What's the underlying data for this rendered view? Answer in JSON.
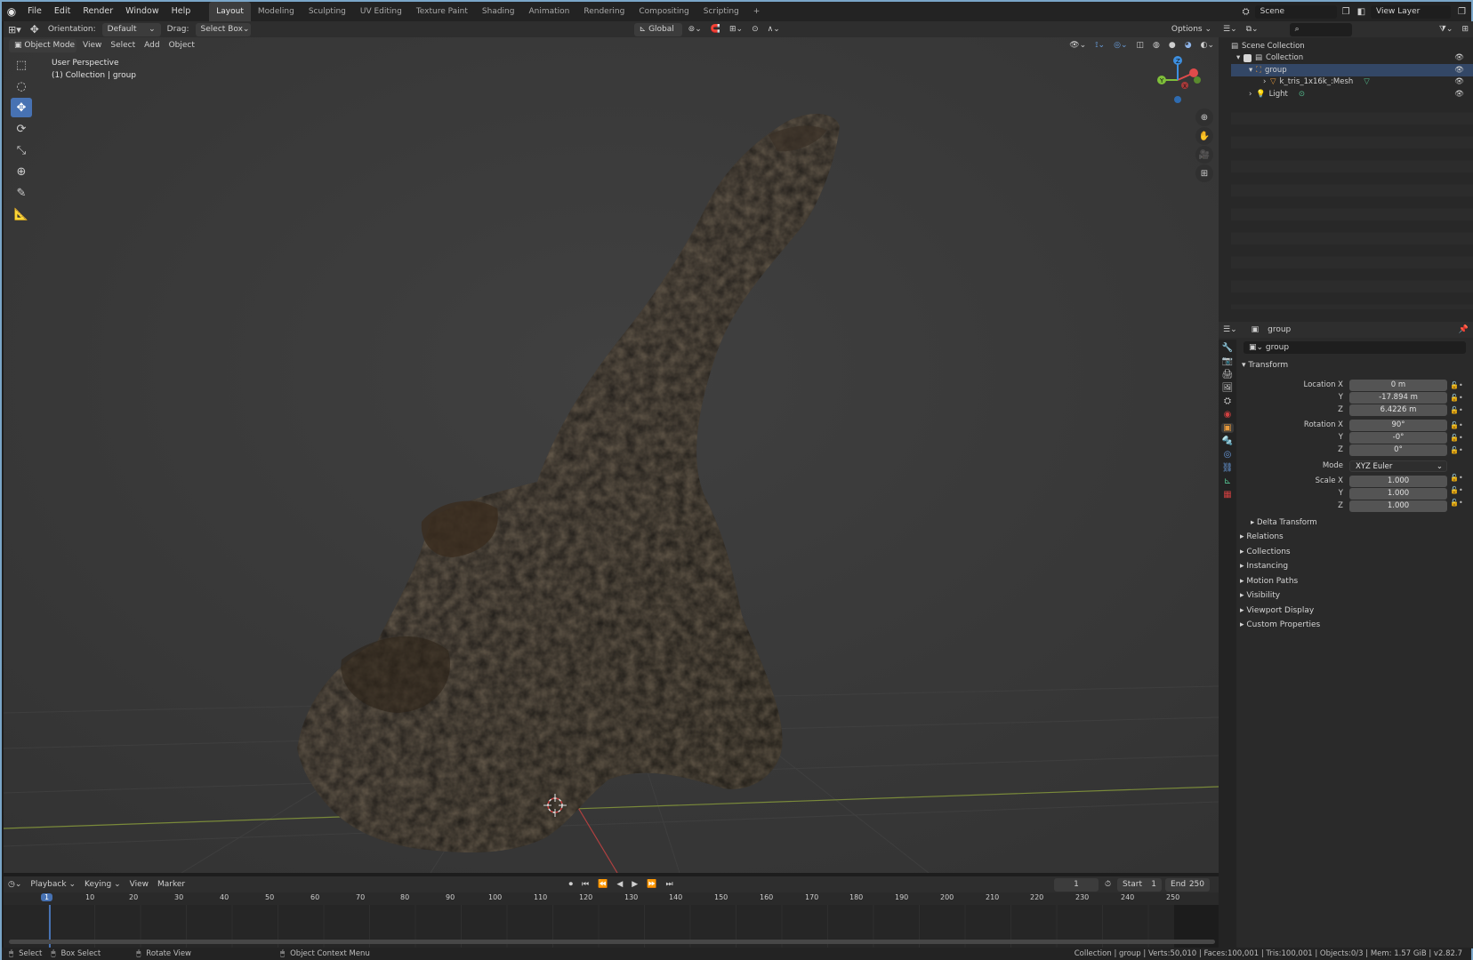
{
  "topbar": {
    "menus": [
      "File",
      "Edit",
      "Render",
      "Window",
      "Help"
    ],
    "workspaces": [
      "Layout",
      "Modeling",
      "Sculpting",
      "UV Editing",
      "Texture Paint",
      "Shading",
      "Animation",
      "Rendering",
      "Compositing",
      "Scripting"
    ],
    "active_workspace": "Layout",
    "add_workspace": "+",
    "scene_name": "Scene",
    "view_layer": "View Layer"
  },
  "tool_header": {
    "orientation_label": "Orientation:",
    "orientation_value": "Default",
    "drag_label": "Drag:",
    "drag_value": "Select Box",
    "transform_orientation": "Global",
    "options": "Options"
  },
  "view_header": {
    "mode": "Object Mode",
    "menus": [
      "View",
      "Select",
      "Add",
      "Object"
    ]
  },
  "viewport": {
    "perspective": "User Perspective",
    "collection_info": "(1) Collection | group",
    "gizmo_axes": [
      "Y",
      "X",
      "Z"
    ],
    "colors": {
      "x_axis": "#e04b4b",
      "y_axis": "#7fbf3a",
      "z_axis": "#3d8fe0",
      "active_tool": "#4772b3"
    }
  },
  "outliner": {
    "rows": [
      {
        "label": "Scene Collection",
        "icon": "scene-collection-icon"
      },
      {
        "label": "Collection",
        "icon": "collection-icon"
      },
      {
        "label": "group",
        "icon": "empty-icon"
      },
      {
        "label": "k_tris_1x16k_:Mesh",
        "icon": "mesh-icon"
      },
      {
        "label": "Light",
        "icon": "light-icon"
      }
    ]
  },
  "properties": {
    "object_name": "group",
    "data_name": "group",
    "transform_header": "Transform",
    "location": {
      "label": "Location X",
      "x": "0 m",
      "y": "-17.894 m",
      "z": "6.4226 m"
    },
    "rotation": {
      "label": "Rotation X",
      "x": "90°",
      "y": "-0°",
      "z": "0°"
    },
    "mode_label": "Mode",
    "mode_value": "XYZ Euler",
    "scale": {
      "label": "Scale X",
      "x": "1.000",
      "y": "1.000",
      "z": "1.000"
    },
    "axis_y": "Y",
    "axis_z": "Z",
    "delta_transform": "Delta Transform",
    "panels": [
      "Relations",
      "Collections",
      "Instancing",
      "Motion Paths",
      "Visibility",
      "Viewport Display",
      "Custom Properties"
    ]
  },
  "timeline": {
    "menus": [
      "Playback",
      "Keying",
      "View",
      "Marker"
    ],
    "current_frame": "1",
    "start_label": "Start",
    "start_value": "1",
    "end_label": "End",
    "end_value": "250",
    "ruler": [
      "1",
      "10",
      "20",
      "30",
      "40",
      "50",
      "60",
      "70",
      "80",
      "90",
      "100",
      "110",
      "120",
      "130",
      "140",
      "150",
      "160",
      "170",
      "180",
      "190",
      "200",
      "210",
      "220",
      "230",
      "240",
      "250"
    ]
  },
  "statusbar": {
    "select": "Select",
    "box_select": "Box Select",
    "rotate_view": "Rotate View",
    "context_menu": "Object Context Menu",
    "stats": "Collection | group | Verts:50,010 | Faces:100,001 | Tris:100,001 | Objects:0/3 | Mem: 1.57 GiB | v2.82.7"
  }
}
